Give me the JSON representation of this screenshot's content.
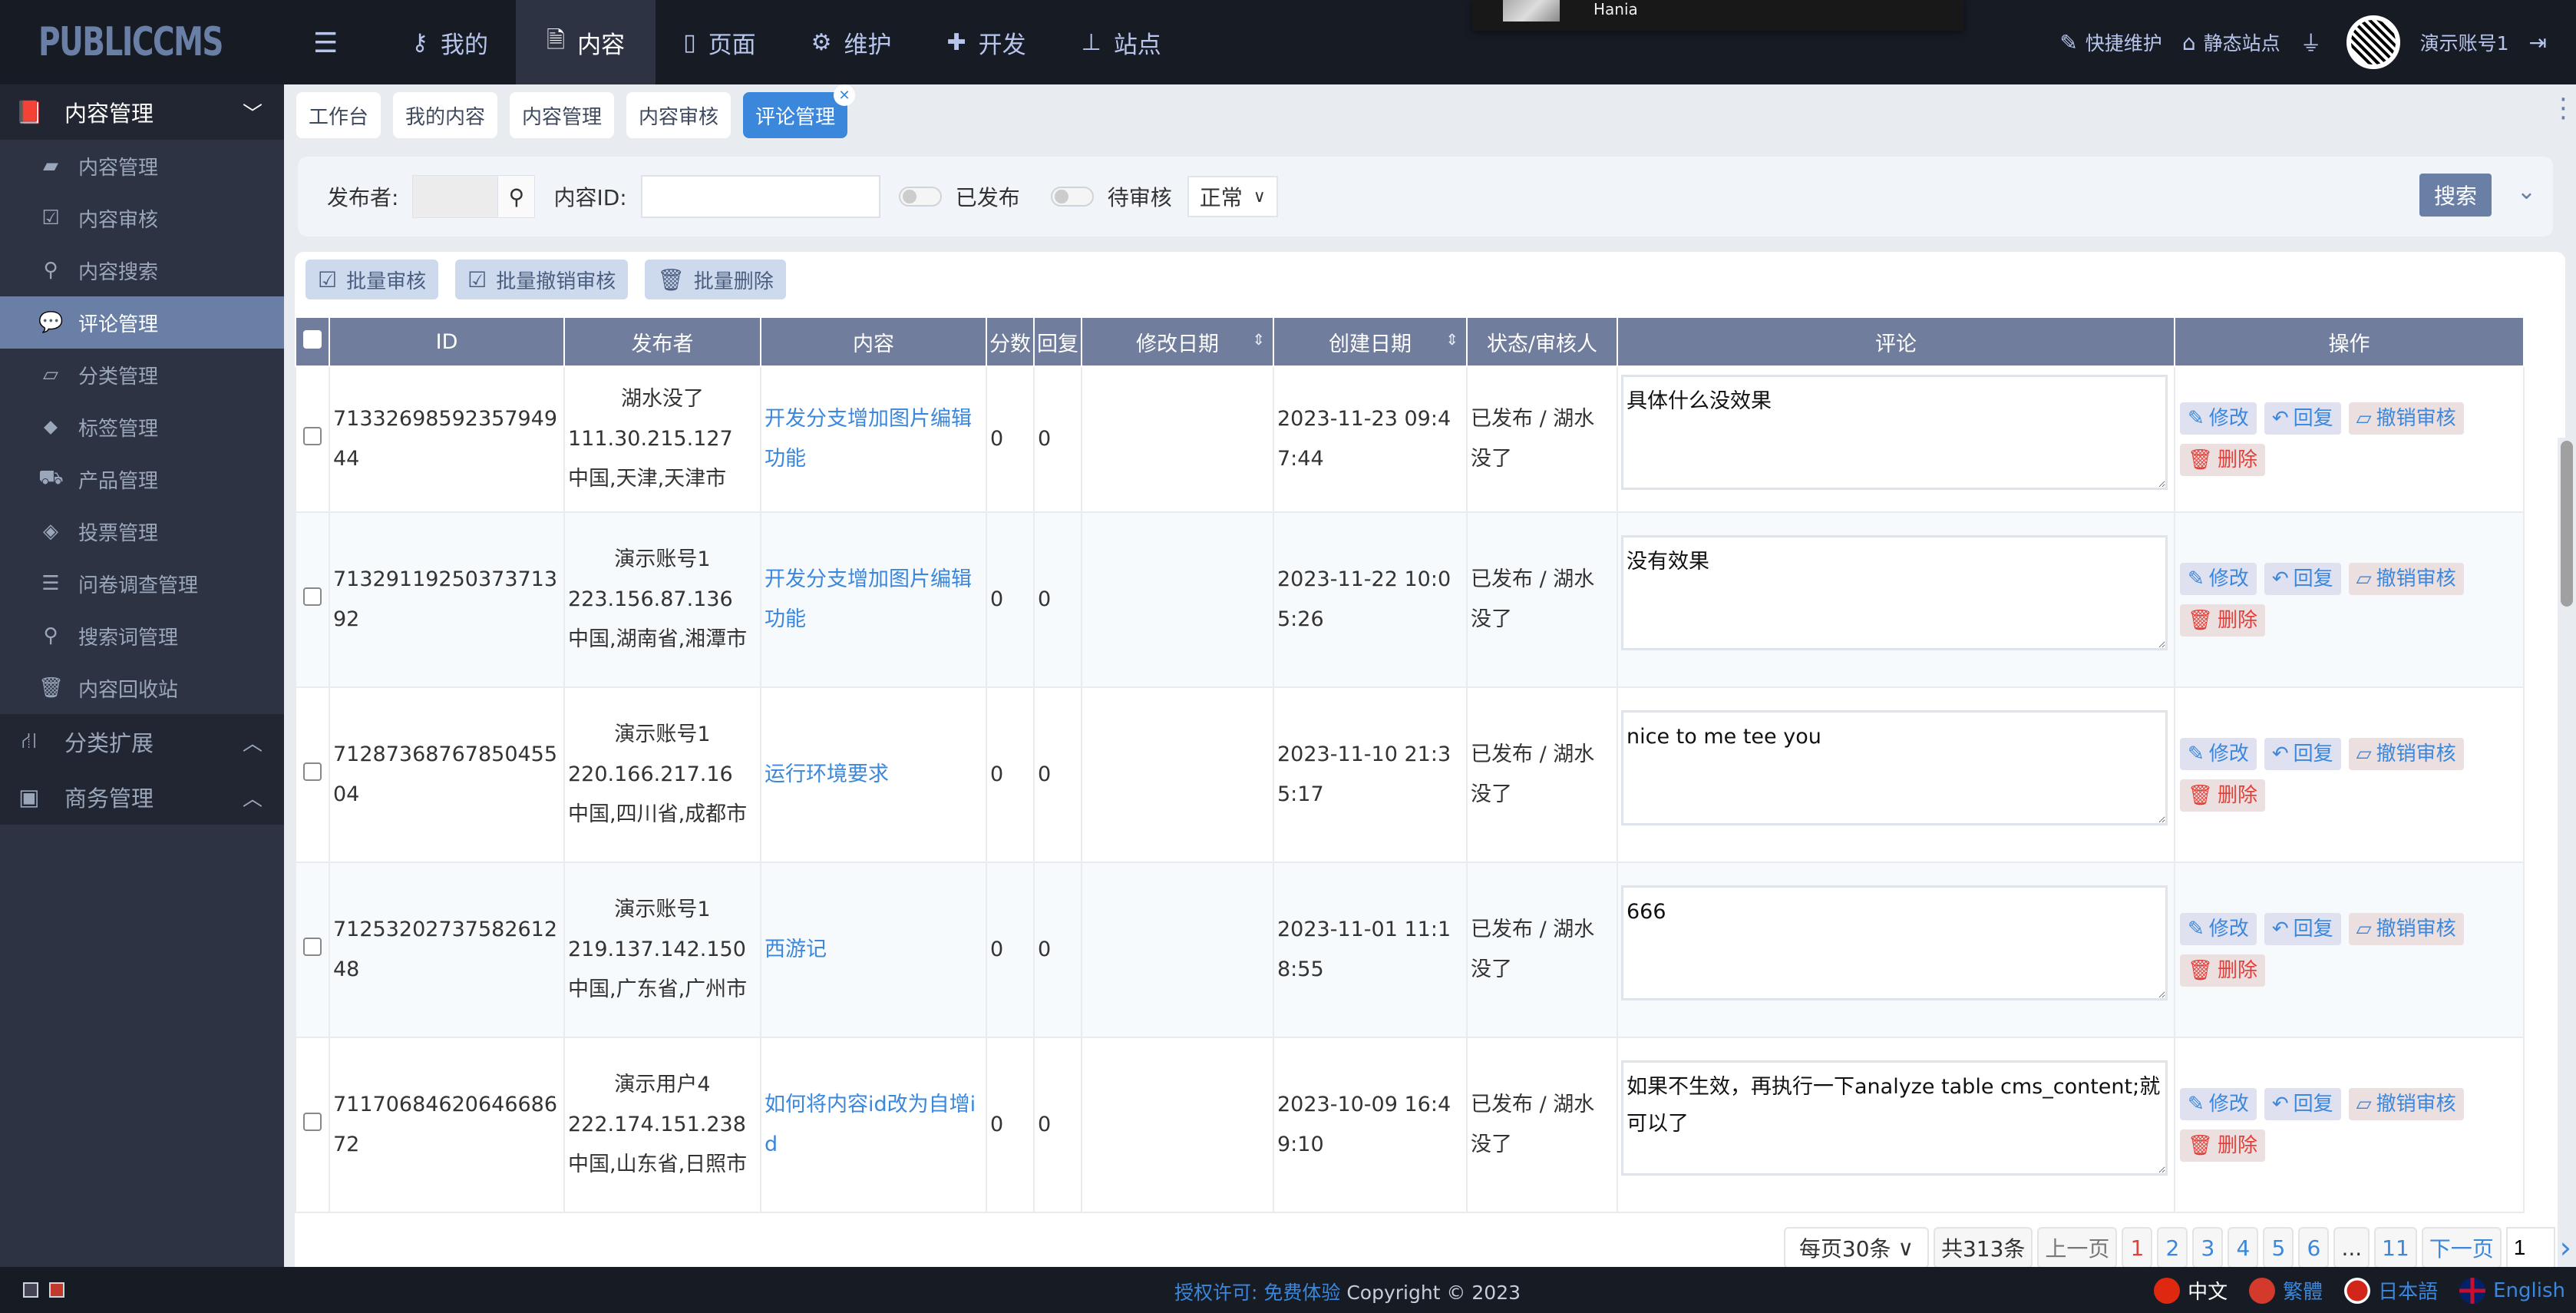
{
  "brand": {
    "logo_text": "PUBLICCMS"
  },
  "topnav": {
    "items": [
      {
        "label": "我的",
        "icon": "key-icon"
      },
      {
        "label": "内容",
        "icon": "file-icon",
        "active": true
      },
      {
        "label": "页面",
        "icon": "mobile-icon"
      },
      {
        "label": "维护",
        "icon": "gears-icon"
      },
      {
        "label": "开发",
        "icon": "puzzle-icon"
      },
      {
        "label": "站点",
        "icon": "sitemap-icon"
      }
    ],
    "right": {
      "quick_maintain": "快捷维护",
      "static_site": "静态站点",
      "user_name": "演示账号1"
    }
  },
  "media_popup": {
    "artist": "Hania"
  },
  "sidebar": {
    "group_title": "内容管理",
    "items": [
      {
        "label": "内容管理",
        "icon": "book-icon"
      },
      {
        "label": "内容审核",
        "icon": "check-square-icon"
      },
      {
        "label": "内容搜索",
        "icon": "search-icon"
      },
      {
        "label": "评论管理",
        "icon": "comment-icon",
        "active": true
      },
      {
        "label": "分类管理",
        "icon": "folder-open-icon"
      },
      {
        "label": "标签管理",
        "icon": "tag-icon"
      },
      {
        "label": "产品管理",
        "icon": "truck-icon"
      },
      {
        "label": "投票管理",
        "icon": "ticket-icon"
      },
      {
        "label": "问卷调查管理",
        "icon": "list-icon"
      },
      {
        "label": "搜索词管理",
        "icon": "search-heart-icon"
      },
      {
        "label": "内容回收站",
        "icon": "trash-icon"
      }
    ],
    "collapsed_groups": [
      {
        "label": "分类扩展",
        "icon": "road-icon"
      },
      {
        "label": "商务管理",
        "icon": "money-icon"
      }
    ]
  },
  "tabs": [
    {
      "label": "工作台"
    },
    {
      "label": "我的内容"
    },
    {
      "label": "内容管理"
    },
    {
      "label": "内容审核"
    },
    {
      "label": "评论管理",
      "active": true
    }
  ],
  "filter": {
    "publisher_label": "发布者:",
    "publisher_value": "",
    "content_id_label": "内容ID:",
    "content_id_value": "",
    "published_label": "已发布",
    "pending_label": "待审核",
    "status_select": "正常",
    "search_button": "搜索"
  },
  "batch": {
    "approve": "批量审核",
    "revoke": "批量撤销审核",
    "delete": "批量删除"
  },
  "table": {
    "headers": [
      "ID",
      "发布者",
      "内容",
      "分数",
      "回复",
      "修改日期",
      "创建日期",
      "状态/审核人",
      "评论",
      "操作"
    ],
    "rows": [
      {
        "id": "7133269859235794944",
        "publisher": "湖水没了",
        "ip": "111.30.215.127",
        "location": "中国,天津,天津市",
        "content": "开发分支增加图片编辑功能",
        "score": "0",
        "replies": "0",
        "modified": "",
        "created": "2023-11-23 09:47:44",
        "status": "已发布 / 湖水没了",
        "comment": "具体什么没效果"
      },
      {
        "id": "7132911925037371392",
        "publisher": "演示账号1",
        "ip": "223.156.87.136",
        "location": "中国,湖南省,湘潭市",
        "content": "开发分支增加图片编辑功能",
        "score": "0",
        "replies": "0",
        "modified": "",
        "created": "2023-11-22 10:05:26",
        "status": "已发布 / 湖水没了",
        "comment": "没有效果"
      },
      {
        "id": "7128736876785045504",
        "publisher": "演示账号1",
        "ip": "220.166.217.16",
        "location": "中国,四川省,成都市",
        "content": "运行环境要求",
        "score": "0",
        "replies": "0",
        "modified": "",
        "created": "2023-11-10 21:35:17",
        "status": "已发布 / 湖水没了",
        "comment": "nice to me tee you"
      },
      {
        "id": "7125320273758261248",
        "publisher": "演示账号1",
        "ip": "219.137.142.150",
        "location": "中国,广东省,广州市",
        "content": "西游记",
        "score": "0",
        "replies": "0",
        "modified": "",
        "created": "2023-11-01 11:18:55",
        "status": "已发布 / 湖水没了",
        "comment": "666"
      },
      {
        "id": "7117068462064668672",
        "publisher": "演示用户4",
        "ip": "222.174.151.238",
        "location": "中国,山东省,日照市",
        "content": "如何将内容id改为自增id",
        "score": "0",
        "replies": "0",
        "modified": "",
        "created": "2023-10-09 16:49:10",
        "status": "已发布 / 湖水没了",
        "comment": "如果不生效，再执行一下analyze table cms_content;就可以了"
      }
    ],
    "actions": {
      "edit": "修改",
      "reply": "回复",
      "revoke": "撤销审核",
      "delete": "删除"
    }
  },
  "pagination": {
    "page_size": "每页30条",
    "total": "共313条",
    "prev": "上一页",
    "pages": [
      "1",
      "2",
      "3",
      "4",
      "5",
      "6",
      "...",
      "11"
    ],
    "current": "1",
    "next": "下一页",
    "jump_value": "1"
  },
  "footer": {
    "license": "授权许可: 免费体验",
    "copyright": "Copyright © 2023",
    "languages": [
      {
        "label": "中文",
        "current": true
      },
      {
        "label": "繁體"
      },
      {
        "label": "日本語"
      },
      {
        "label": "English"
      }
    ]
  },
  "colors": {
    "accent": "#3a87dc",
    "primary": "#6a7fa6",
    "danger": "#e0413a",
    "topbar": "#161b24",
    "sidebar": "#2e3344"
  }
}
